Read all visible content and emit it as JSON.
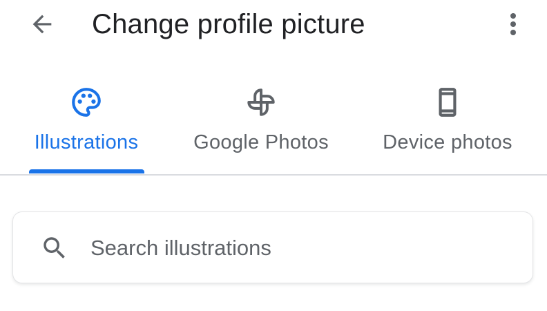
{
  "header": {
    "title": "Change profile picture",
    "back_icon": "arrow-back-icon",
    "more_icon": "more-vert-icon"
  },
  "tabs": [
    {
      "label": "Illustrations",
      "icon": "palette-icon",
      "active": true
    },
    {
      "label": "Google Photos",
      "icon": "pinwheel-icon",
      "active": false
    },
    {
      "label": "Device photos",
      "icon": "smartphone-icon",
      "active": false
    }
  ],
  "search": {
    "placeholder": "Search illustrations",
    "value": "",
    "icon": "search-icon"
  },
  "colors": {
    "accent": "#1a73e8",
    "text_primary": "#202124",
    "text_secondary": "#5f6368",
    "divider": "#dadce0"
  }
}
